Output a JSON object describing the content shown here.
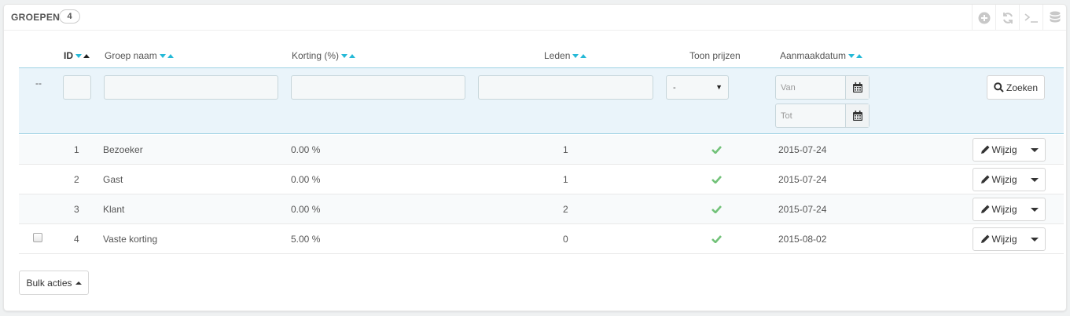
{
  "panel": {
    "title": "Groepen",
    "count": "4"
  },
  "toolbar": {
    "icons": [
      "add-icon",
      "refresh-icon",
      "sql-query-icon",
      "database-icon"
    ]
  },
  "columns": {
    "id": "ID",
    "name": "Groep naam",
    "discount": "Korting (%)",
    "members": "Leden",
    "show_prices": "Toon prijzen",
    "created": "Aanmaakdatum"
  },
  "filters": {
    "dash": "--",
    "show_prices_selected": "-",
    "date_from_placeholder": "Van",
    "date_to_placeholder": "Tot",
    "search_label": "Zoeken"
  },
  "rows": [
    {
      "id": "1",
      "name": "Bezoeker",
      "discount": "0.00 %",
      "members": "1",
      "show_prices": true,
      "created": "2015-07-24",
      "edit_label": "Wijzig",
      "has_checkbox": false
    },
    {
      "id": "2",
      "name": "Gast",
      "discount": "0.00 %",
      "members": "1",
      "show_prices": true,
      "created": "2015-07-24",
      "edit_label": "Wijzig",
      "has_checkbox": false
    },
    {
      "id": "3",
      "name": "Klant",
      "discount": "0.00 %",
      "members": "2",
      "show_prices": true,
      "created": "2015-07-24",
      "edit_label": "Wijzig",
      "has_checkbox": false
    },
    {
      "id": "4",
      "name": "Vaste korting",
      "discount": "5.00 %",
      "members": "0",
      "show_prices": true,
      "created": "2015-08-02",
      "edit_label": "Wijzig",
      "has_checkbox": true
    }
  ],
  "bulk": {
    "label": "Bulk acties"
  },
  "colors": {
    "accent": "#25b9d7",
    "check": "#72c279",
    "filter_bg": "#eaf4fa"
  }
}
